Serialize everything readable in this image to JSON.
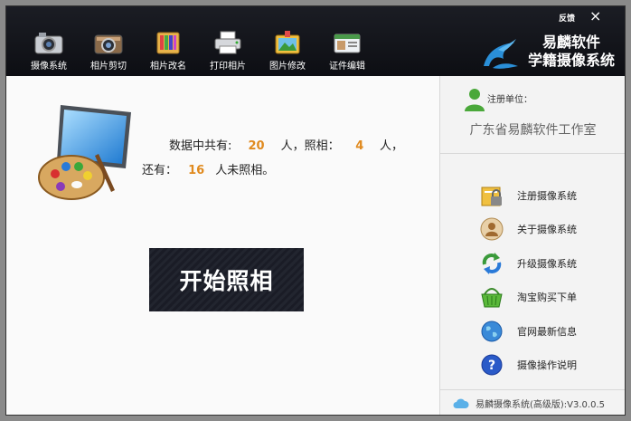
{
  "window": {
    "feedback_label": "反馈",
    "close_glyph": "×"
  },
  "toolbar": [
    {
      "label": "摄像系统",
      "icon": "camera-icon"
    },
    {
      "label": "相片剪切",
      "icon": "photo-camera-crop-icon"
    },
    {
      "label": "相片改名",
      "icon": "files-rename-icon"
    },
    {
      "label": "打印相片",
      "icon": "printer-icon"
    },
    {
      "label": "图片修改",
      "icon": "image-edit-icon"
    },
    {
      "label": "证件编辑",
      "icon": "id-card-icon"
    }
  ],
  "brand": {
    "line1": "易麟软件",
    "line2": "学籍摄像系统",
    "logo_icon": "dragon-logo-icon"
  },
  "stats": {
    "prefix": "数据中共有:",
    "total": "20",
    "mid1": "人，照相：",
    "photographed": "4",
    "mid2": "人，",
    "prefix2": "还有：",
    "not_photographed": "16",
    "suffix2": "人未照相。"
  },
  "start_button": {
    "label": "开始照相"
  },
  "registration": {
    "label": "注册单位：",
    "value": "广东省易麟软件工作室"
  },
  "menu": [
    {
      "label": "注册摄像系统",
      "icon": "register-lock-icon"
    },
    {
      "label": "关于摄像系统",
      "icon": "about-person-icon"
    },
    {
      "label": "升级摄像系统",
      "icon": "upgrade-arrows-icon"
    },
    {
      "label": "淘宝购买下单",
      "icon": "shopping-basket-icon"
    },
    {
      "label": "官网最新信息",
      "icon": "globe-icon"
    },
    {
      "label": "摄像操作说明",
      "icon": "help-icon"
    }
  ],
  "footer": {
    "version": "易麟摄像系统(高级版):V3.0.0.5",
    "icon": "cloud-icon"
  },
  "colors": {
    "accent_orange": "#e08a1e",
    "header_bg": "#111217",
    "button_bg": "#1d1f29"
  }
}
